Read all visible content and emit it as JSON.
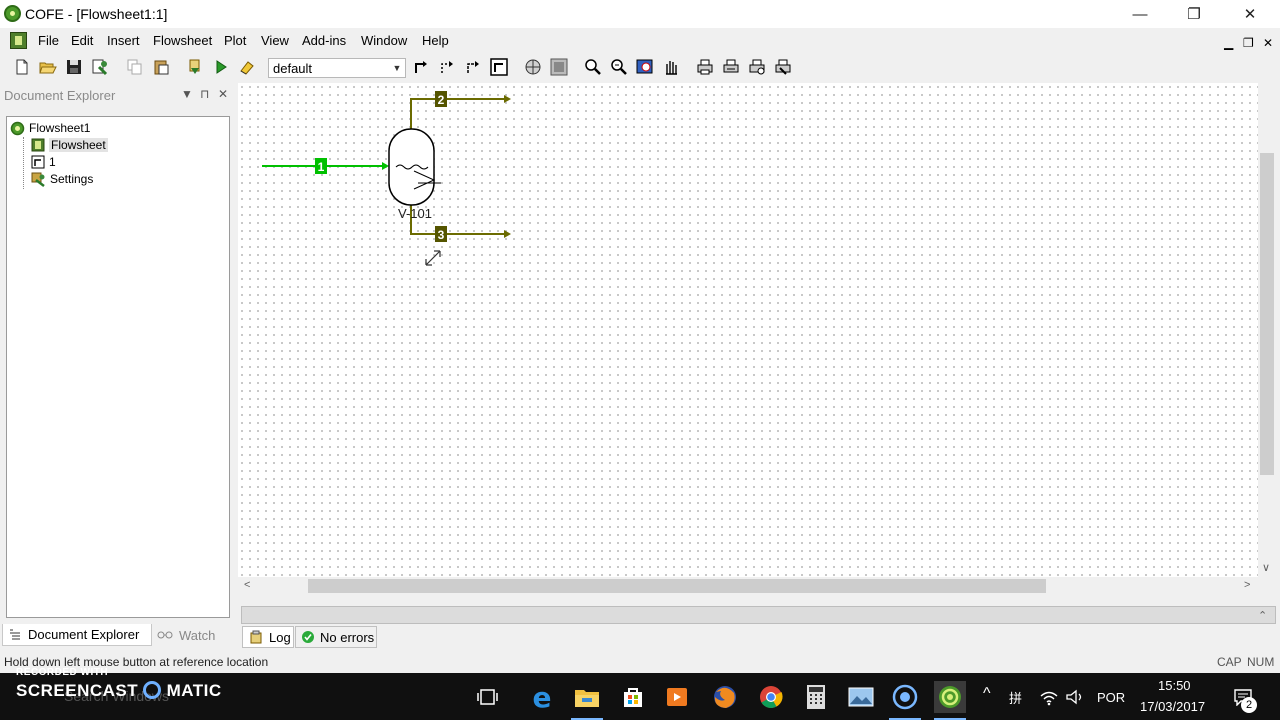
{
  "window": {
    "title": "COFE - [Flowsheet1:1]",
    "controls": {
      "minimize": "—",
      "restore": "❐",
      "close": "✕"
    }
  },
  "menu": {
    "items": [
      "File",
      "Edit",
      "Insert",
      "Flowsheet",
      "Plot",
      "View",
      "Add-ins",
      "Window",
      "Help"
    ],
    "mdi": {
      "minimize": "▁",
      "restore": "❐",
      "close": "✕"
    }
  },
  "toolbar": {
    "unit_system": "default",
    "icons": [
      "new-icon",
      "open-icon",
      "save-icon",
      "properties-icon",
      "copy-icon",
      "paste-icon",
      "validate-icon",
      "run-icon",
      "clear-icon",
      "stream-icon",
      "energy-stream-icon",
      "info-stream-icon",
      "reverse-stream-icon",
      "unit-icon",
      "zoom-fit-icon",
      "zoom-page-icon",
      "zoom-in-icon",
      "zoom-out-icon",
      "zoom-window-icon",
      "pan-icon",
      "print-icon",
      "print-setup-icon",
      "print-preview-icon",
      "export-icon"
    ]
  },
  "explorer": {
    "title": "Document Explorer",
    "tree": {
      "root": "Flowsheet1",
      "children": [
        "Flowsheet",
        "1",
        "Settings"
      ]
    },
    "tabs": [
      "Document Explorer",
      "Watch"
    ]
  },
  "flowsheet": {
    "unit_label": "V-101",
    "streams": {
      "feed": "1",
      "vapor": "2",
      "liquid": "3"
    },
    "colors": {
      "feed": "#00c000",
      "outlet": "#6b6b00",
      "outlet_badge": "#555500"
    }
  },
  "output": {
    "tabs": [
      "Log",
      "No errors"
    ]
  },
  "status": {
    "message": "Hold down left mouse button at reference location",
    "cap": "CAP",
    "num": "NUM"
  },
  "taskbar": {
    "watermark_top": "RECORDED WITH",
    "watermark_brand": "SCREENCAST",
    "watermark_brand2": "MATIC",
    "search_placeholder": "Search Windows",
    "language": "POR",
    "time": "15:50",
    "date": "17/03/2017",
    "notification_count": "2"
  }
}
